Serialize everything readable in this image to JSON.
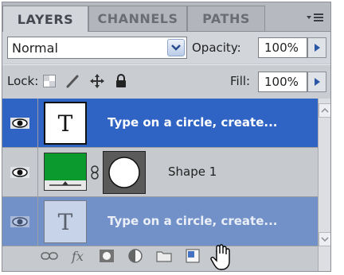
{
  "tabs": [
    {
      "label": "LAYERS",
      "active": true
    },
    {
      "label": "CHANNELS",
      "active": false
    },
    {
      "label": "PATHS",
      "active": false
    }
  ],
  "panel_menu_icon": "panel-menu-icon",
  "blend_mode": {
    "value": "Normal"
  },
  "opacity": {
    "label": "Opacity:",
    "value": "100%"
  },
  "lock": {
    "label": "Lock:",
    "icons": [
      "lock-transparent-icon",
      "lock-image-icon",
      "lock-position-icon",
      "lock-all-icon"
    ]
  },
  "fill": {
    "label": "Fill:",
    "value": "100%"
  },
  "layers": [
    {
      "name": "Type on a circle, create...",
      "kind": "type",
      "thumb_letter": "T",
      "selected": true,
      "visible": true
    },
    {
      "name": "Shape 1",
      "kind": "shape",
      "fill_color": "#0a9a2e",
      "selected": false,
      "visible": true
    },
    {
      "name": "Type on a circle, create...",
      "kind": "type",
      "thumb_letter": "T",
      "selected": true,
      "visible": true,
      "dragging": true
    }
  ],
  "footer_icons": [
    "link-layers-icon",
    "layer-style-icon",
    "layer-mask-icon",
    "adjustment-layer-icon",
    "new-group-icon",
    "new-layer-icon",
    "delete-layer-icon"
  ],
  "colors": {
    "selection": "#2f63c4",
    "panel": "#c6c9ce",
    "shape_fill": "#0a9a2e"
  }
}
